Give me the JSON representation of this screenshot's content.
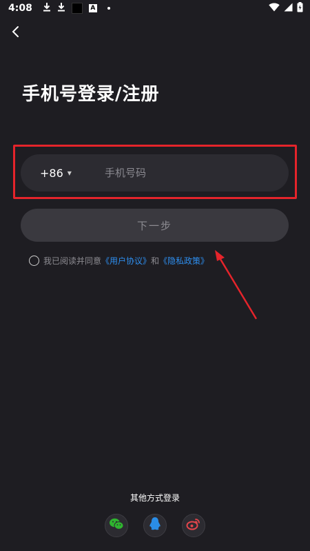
{
  "status_bar": {
    "time": "4:08",
    "a_label": "A",
    "icons": [
      "download-icon",
      "download-icon",
      "black-square-icon",
      "a-icon",
      "dot-icon",
      "wifi-icon",
      "signal-icon",
      "battery-icon"
    ]
  },
  "header": {
    "back_icon": "chevron-left-icon",
    "title": "手机号登录/注册"
  },
  "form": {
    "country_code": "+86",
    "phone_placeholder": "手机号码",
    "phone_value": "",
    "next_label": "下一步"
  },
  "agreement": {
    "prefix": "我已阅读并同意",
    "user_agreement": "《用户协议》",
    "conjunction": "和",
    "privacy_policy": "《隐私政策》"
  },
  "other_login": {
    "title": "其他方式登录",
    "methods": [
      "wechat-icon",
      "qq-icon",
      "weibo-icon"
    ]
  },
  "colors": {
    "background": "#1e1d22",
    "input_bg": "#2c2b31",
    "button_bg": "#3a393f",
    "highlight": "#e5242b",
    "link": "#2e8ff0",
    "wechat": "#2fb52f",
    "qq": "#2a8de6",
    "weibo": "#e5464c"
  }
}
